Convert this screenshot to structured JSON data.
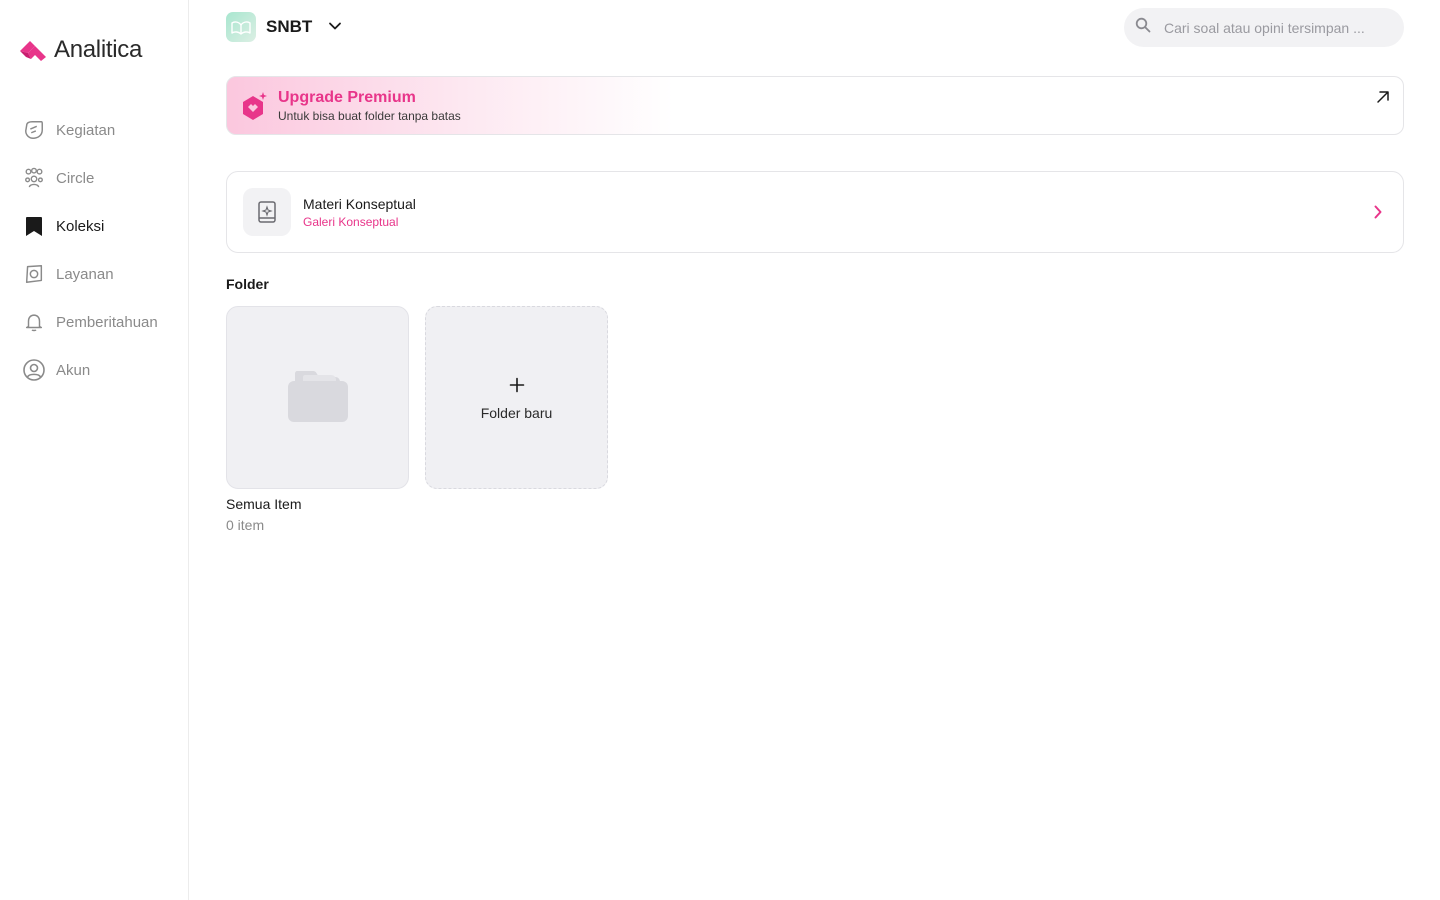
{
  "app": {
    "name": "Analitica",
    "brand_color": "#e8358a"
  },
  "sidebar": {
    "items": [
      {
        "label": "Kegiatan",
        "icon": "activity-icon",
        "active": false
      },
      {
        "label": "Circle",
        "icon": "people-icon",
        "active": false
      },
      {
        "label": "Koleksi",
        "icon": "bookmark-icon",
        "active": true
      },
      {
        "label": "Layanan",
        "icon": "compass-icon",
        "active": false
      },
      {
        "label": "Pemberitahuan",
        "icon": "bell-icon",
        "active": false
      },
      {
        "label": "Akun",
        "icon": "user-circle-icon",
        "active": false
      }
    ]
  },
  "header": {
    "program": "SNBT",
    "search_placeholder": "Cari soal atau opini tersimpan ..."
  },
  "premium": {
    "title": "Upgrade Premium",
    "subtitle": "Untuk bisa buat folder tanpa batas"
  },
  "materi": {
    "title": "Materi Konseptual",
    "subtitle": "Galeri Konseptual"
  },
  "folders": {
    "heading": "Folder",
    "all_name": "Semua Item",
    "all_count": "0 item",
    "new_label": "Folder baru"
  }
}
